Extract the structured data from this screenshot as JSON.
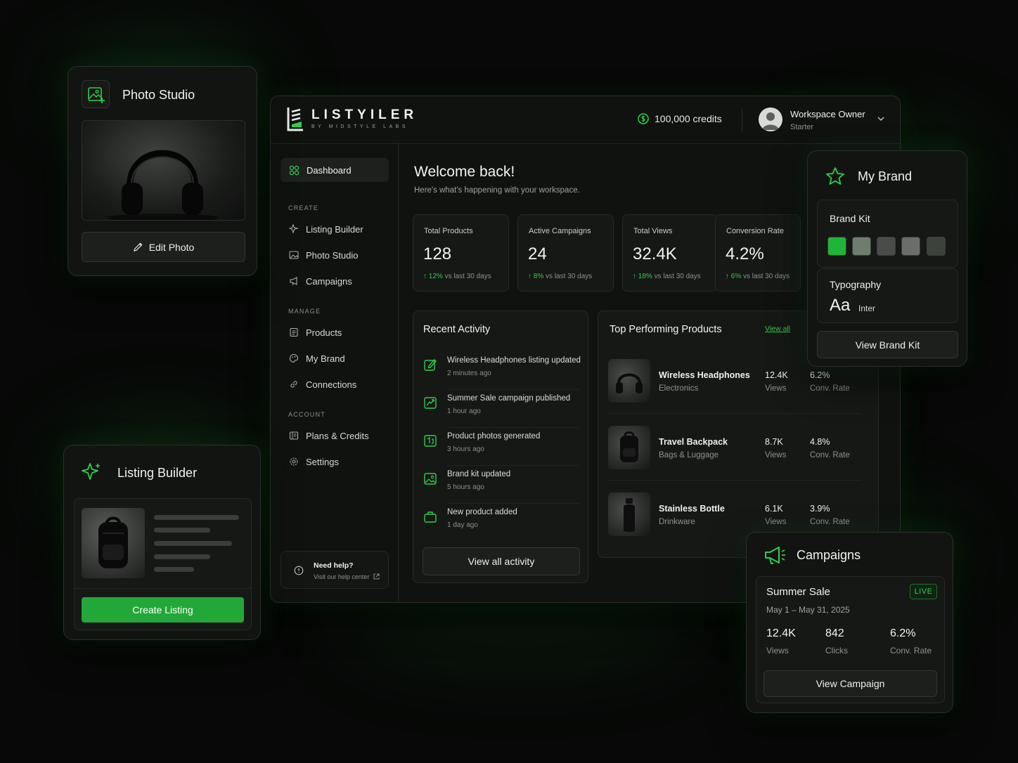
{
  "brand": {
    "logo_name": "LISTYILER",
    "logo_sub": "BY MIDSTYLE LABS",
    "accent": "#2fcf4a"
  },
  "header": {
    "credits": "100,000 credits",
    "workspace_name": "Workspace Owner",
    "workspace_plan": "Starter"
  },
  "sidebar": {
    "dashboard": "Dashboard",
    "sections": {
      "create": "CREATE",
      "manage": "MANAGE",
      "account": "ACCOUNT"
    },
    "items": {
      "listing_builder": "Listing Builder",
      "photo_studio": "Photo Studio",
      "campaigns": "Campaigns",
      "products": "Products",
      "my_brand": "My Brand",
      "connections": "Connections",
      "plans": "Plans & Credits",
      "settings": "Settings"
    },
    "help": {
      "title": "Need help?",
      "link": "Visit our help center"
    }
  },
  "welcome": {
    "title": "Welcome back!",
    "subtitle": "Here's what's happening with your workspace."
  },
  "stats": [
    {
      "label": "Total Products",
      "value": "128",
      "change": "12%",
      "period": "vs last 30 days"
    },
    {
      "label": "Active Campaigns",
      "value": "24",
      "change": "8%",
      "period": "vs last 30 days"
    },
    {
      "label": "Total Views",
      "value": "32.4K",
      "change": "18%",
      "period": "vs last 30 days"
    },
    {
      "label": "Conversion Rate",
      "value": "4.2%",
      "change": "6%",
      "period": "vs last 30 days"
    }
  ],
  "activity": {
    "title": "Recent Activity",
    "items": [
      {
        "text": "Wireless Headphones listing updated",
        "time": "2 minutes ago"
      },
      {
        "text": "Summer Sale campaign published",
        "time": "1 hour ago"
      },
      {
        "text": "Product photos generated",
        "time": "3 hours ago"
      },
      {
        "text": "Brand kit updated",
        "time": "5 hours ago"
      },
      {
        "text": "New product added",
        "time": "1 day ago"
      }
    ],
    "view_all": "View all activity"
  },
  "top_products": {
    "title": "Top Performing Products",
    "view_all": "View all",
    "items": [
      {
        "name": "Wireless Headphones",
        "category": "Electronics",
        "views": "12.4K",
        "views_label": "Views",
        "conv": "6.2%",
        "conv_label": "Conv. Rate"
      },
      {
        "name": "Travel Backpack",
        "category": "Bags & Luggage",
        "views": "8.7K",
        "views_label": "Views",
        "conv": "4.8%",
        "conv_label": "Conv. Rate"
      },
      {
        "name": "Stainless Bottle",
        "category": "Drinkware",
        "views": "6.1K",
        "views_label": "Views",
        "conv": "3.9%",
        "conv_label": "Conv. Rate"
      }
    ]
  },
  "photo_studio_card": {
    "title": "Photo Studio",
    "button": "Edit Photo"
  },
  "listing_builder_card": {
    "title": "Listing Builder",
    "button": "Create Listing"
  },
  "my_brand_card": {
    "title": "My Brand",
    "brand_kit": "Brand Kit",
    "swatches": [
      "#1fb43a",
      "#6f7d6f",
      "#4a4c4a",
      "#6a6d6a",
      "#3c423c"
    ],
    "typography": "Typography",
    "font_sample": "Aa",
    "font_name": "Inter",
    "button": "View Brand Kit"
  },
  "campaign_card": {
    "title": "Campaigns",
    "name": "Summer Sale",
    "status": "LIVE",
    "dates": "May 1 – May 31, 2025",
    "views": "12.4K",
    "views_label": "Views",
    "clicks": "842",
    "clicks_label": "Clicks",
    "conv": "6.2%",
    "conv_label": "Conv. Rate",
    "button": "View Campaign"
  }
}
